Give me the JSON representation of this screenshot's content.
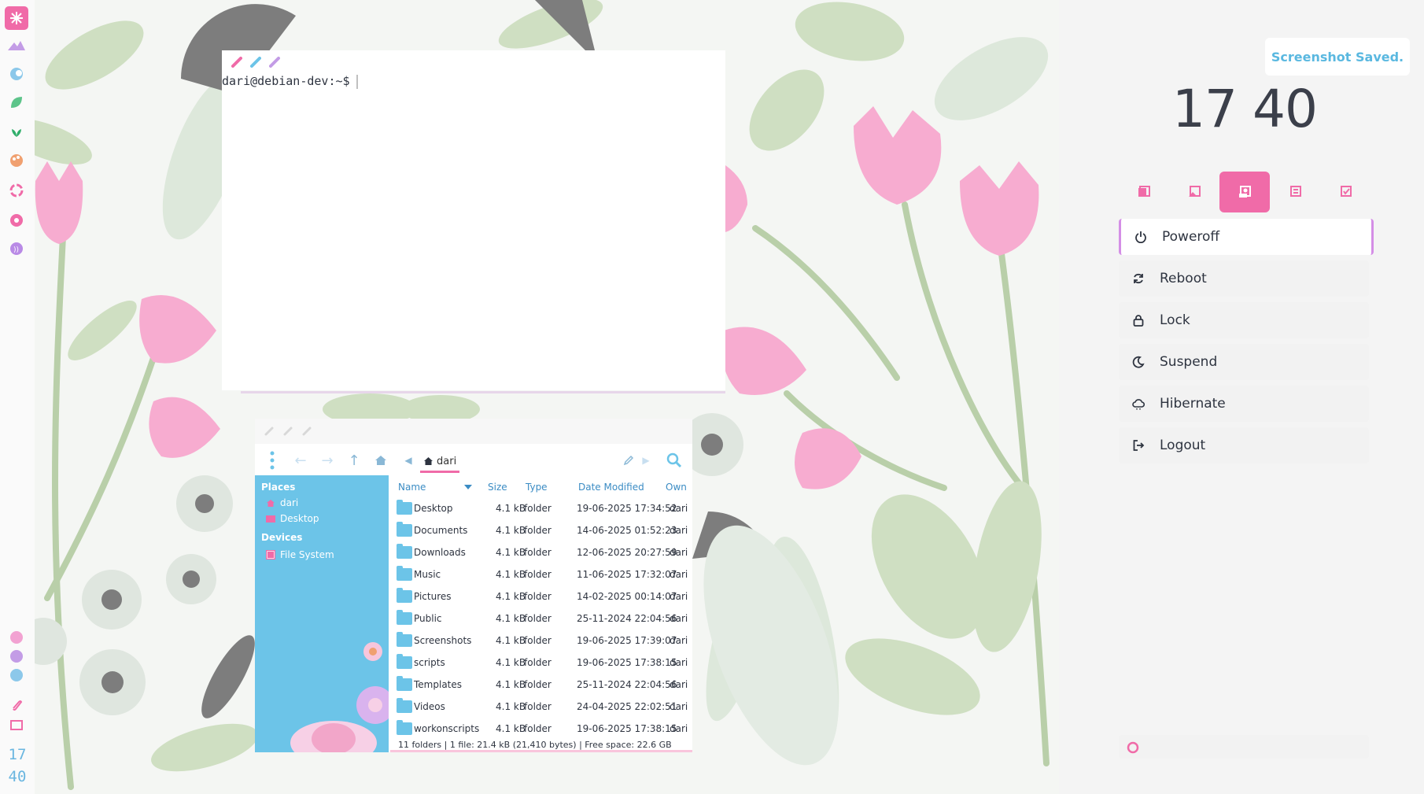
{
  "terminal": {
    "prompt": "dari@debian-dev:~$"
  },
  "dock": {
    "clock_hour": "17",
    "clock_minute": "40"
  },
  "file_manager": {
    "breadcrumb": "dari",
    "sidebar": {
      "places_title": "Places",
      "places": [
        "dari",
        "Desktop"
      ],
      "devices_title": "Devices",
      "devices": [
        "File System"
      ]
    },
    "columns": [
      "Name",
      "Size",
      "Type",
      "Date Modified",
      "Own"
    ],
    "rows": [
      {
        "name": "Desktop",
        "size": "4.1 kB",
        "type": "folder",
        "date": "19-06-2025 17:34:52",
        "owner": "dari"
      },
      {
        "name": "Documents",
        "size": "4.1 kB",
        "type": "folder",
        "date": "14-06-2025 01:52:23",
        "owner": "dari"
      },
      {
        "name": "Downloads",
        "size": "4.1 kB",
        "type": "folder",
        "date": "12-06-2025 20:27:59",
        "owner": "dari"
      },
      {
        "name": "Music",
        "size": "4.1 kB",
        "type": "folder",
        "date": "11-06-2025 17:32:07",
        "owner": "dari"
      },
      {
        "name": "Pictures",
        "size": "4.1 kB",
        "type": "folder",
        "date": "14-02-2025 00:14:07",
        "owner": "dari"
      },
      {
        "name": "Public",
        "size": "4.1 kB",
        "type": "folder",
        "date": "25-11-2024 22:04:56",
        "owner": "dari"
      },
      {
        "name": "Screenshots",
        "size": "4.1 kB",
        "type": "folder",
        "date": "19-06-2025 17:39:07",
        "owner": "dari"
      },
      {
        "name": "scripts",
        "size": "4.1 kB",
        "type": "folder",
        "date": "19-06-2025 17:38:15",
        "owner": "dari"
      },
      {
        "name": "Templates",
        "size": "4.1 kB",
        "type": "folder",
        "date": "25-11-2024 22:04:56",
        "owner": "dari"
      },
      {
        "name": "Videos",
        "size": "4.1 kB",
        "type": "folder",
        "date": "24-04-2025 22:02:51",
        "owner": "dari"
      },
      {
        "name": "workonscripts",
        "size": "4.1 kB",
        "type": "folder",
        "date": "19-06-2025 17:38:15",
        "owner": "dari"
      }
    ],
    "status": "11 folders  |  1 file: 21.4 kB (21,410 bytes)  |  Free space: 22.6 GB"
  },
  "panel": {
    "toast": "Screenshot Saved.",
    "clock": "17 40",
    "tabs": [
      "tab-1",
      "tab-2",
      "tab-3",
      "tab-4",
      "tab-5"
    ],
    "active_tab": 2,
    "items": [
      {
        "label": "Poweroff",
        "icon": "power-icon"
      },
      {
        "label": "Reboot",
        "icon": "refresh-icon"
      },
      {
        "label": "Lock",
        "icon": "lock-icon"
      },
      {
        "label": "Suspend",
        "icon": "moon-icon"
      },
      {
        "label": "Hibernate",
        "icon": "cloud-icon"
      },
      {
        "label": "Logout",
        "icon": "logout-icon"
      }
    ]
  },
  "colors": {
    "accent_pink": "#f06ba8",
    "accent_blue": "#6cc4e8",
    "accent_purple": "#d48ee6"
  }
}
